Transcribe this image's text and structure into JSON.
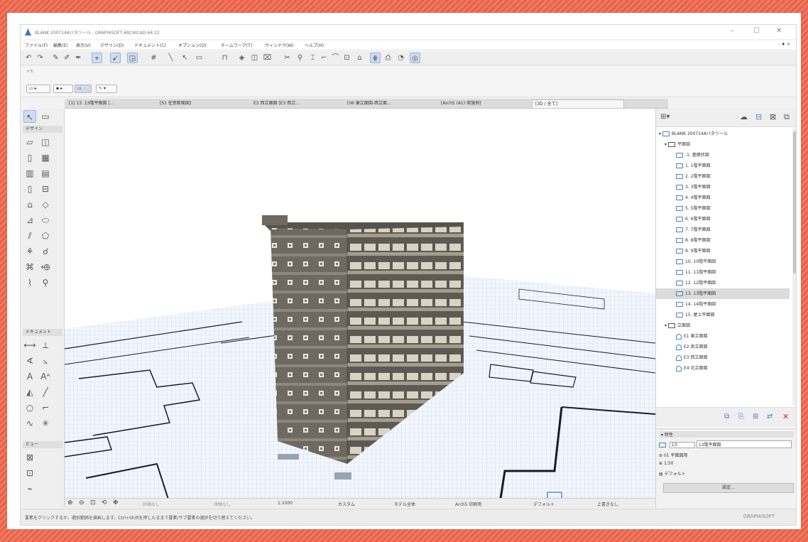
{
  "window": {
    "title": "BLANK 200714Aバタツール - GRAPHISOFT ARCHICAD-64 22",
    "controls": [
      "–",
      "☐",
      "✕"
    ]
  },
  "menu": {
    "items": [
      "ファイル(F)",
      "編集(E)",
      "表示(V)",
      "デザイン(D)",
      "ドキュメント(C)",
      "オプション(O)",
      "チームワーク(T)",
      "ウィンドウ(W)",
      "ヘルプ(H)"
    ],
    "right": "- ♦ ×"
  },
  "infobox": {
    "label": "メモ:"
  },
  "tabs": [
    "[1] 13. 13階平面図 [...",
    "[S1 任意断面図]",
    "E3 西立面図 [E3 西立...",
    "[06 東立面図-西立面...",
    "[Arch5 (A1) 実施例]",
    "[3D / 全て]"
  ],
  "toolbox": {
    "categories": [
      "デザイン",
      "ドキュメント",
      "ビュー"
    ]
  },
  "viewbar": {
    "items": [
      "詳細なし",
      "詳細なし",
      "1:1000",
      "カスタム",
      "モデル全体",
      "Arch5 印刷用",
      "デフォルト",
      "上書きなし"
    ]
  },
  "statusbar": {
    "message": "要素をクリックするか、選択範囲を描画します。Ctrl+Shiftを押したままで要素/サブ要素の選択を切り替えてください。",
    "brand": "GRAPHISOFT"
  },
  "navigator": {
    "project": "BLANK 200714Aバタツール",
    "floor_plans_folder": "平面図",
    "floor_plans": [
      "-1. 基礎伏図",
      "1. 1階平面図",
      "2. 2階平面図",
      "3. 3階平面図",
      "4. 4階平面図",
      "5. 5階平面図",
      "6. 6階平面図",
      "7. 7階平面図",
      "8. 8階平面図",
      "9. 9階平面図",
      "10. 10階平面図",
      "11. 11階平面図",
      "12. 12階平面図",
      "13. 13階平面図",
      "14. 14階平面図",
      "15. 屋上平面図"
    ],
    "selected_index": 13,
    "elevations_folder": "立面図",
    "elevations": [
      "E1 東立面図",
      "E2 南立面図",
      "E3 西立面図",
      "E4 北立面図"
    ]
  },
  "properties": {
    "header": "特性",
    "id": "13.",
    "name": "13階平面図",
    "layer_combo": "01 平面図用",
    "scale": "1:50",
    "default": "デフォルト",
    "settings_button": "設定..."
  }
}
